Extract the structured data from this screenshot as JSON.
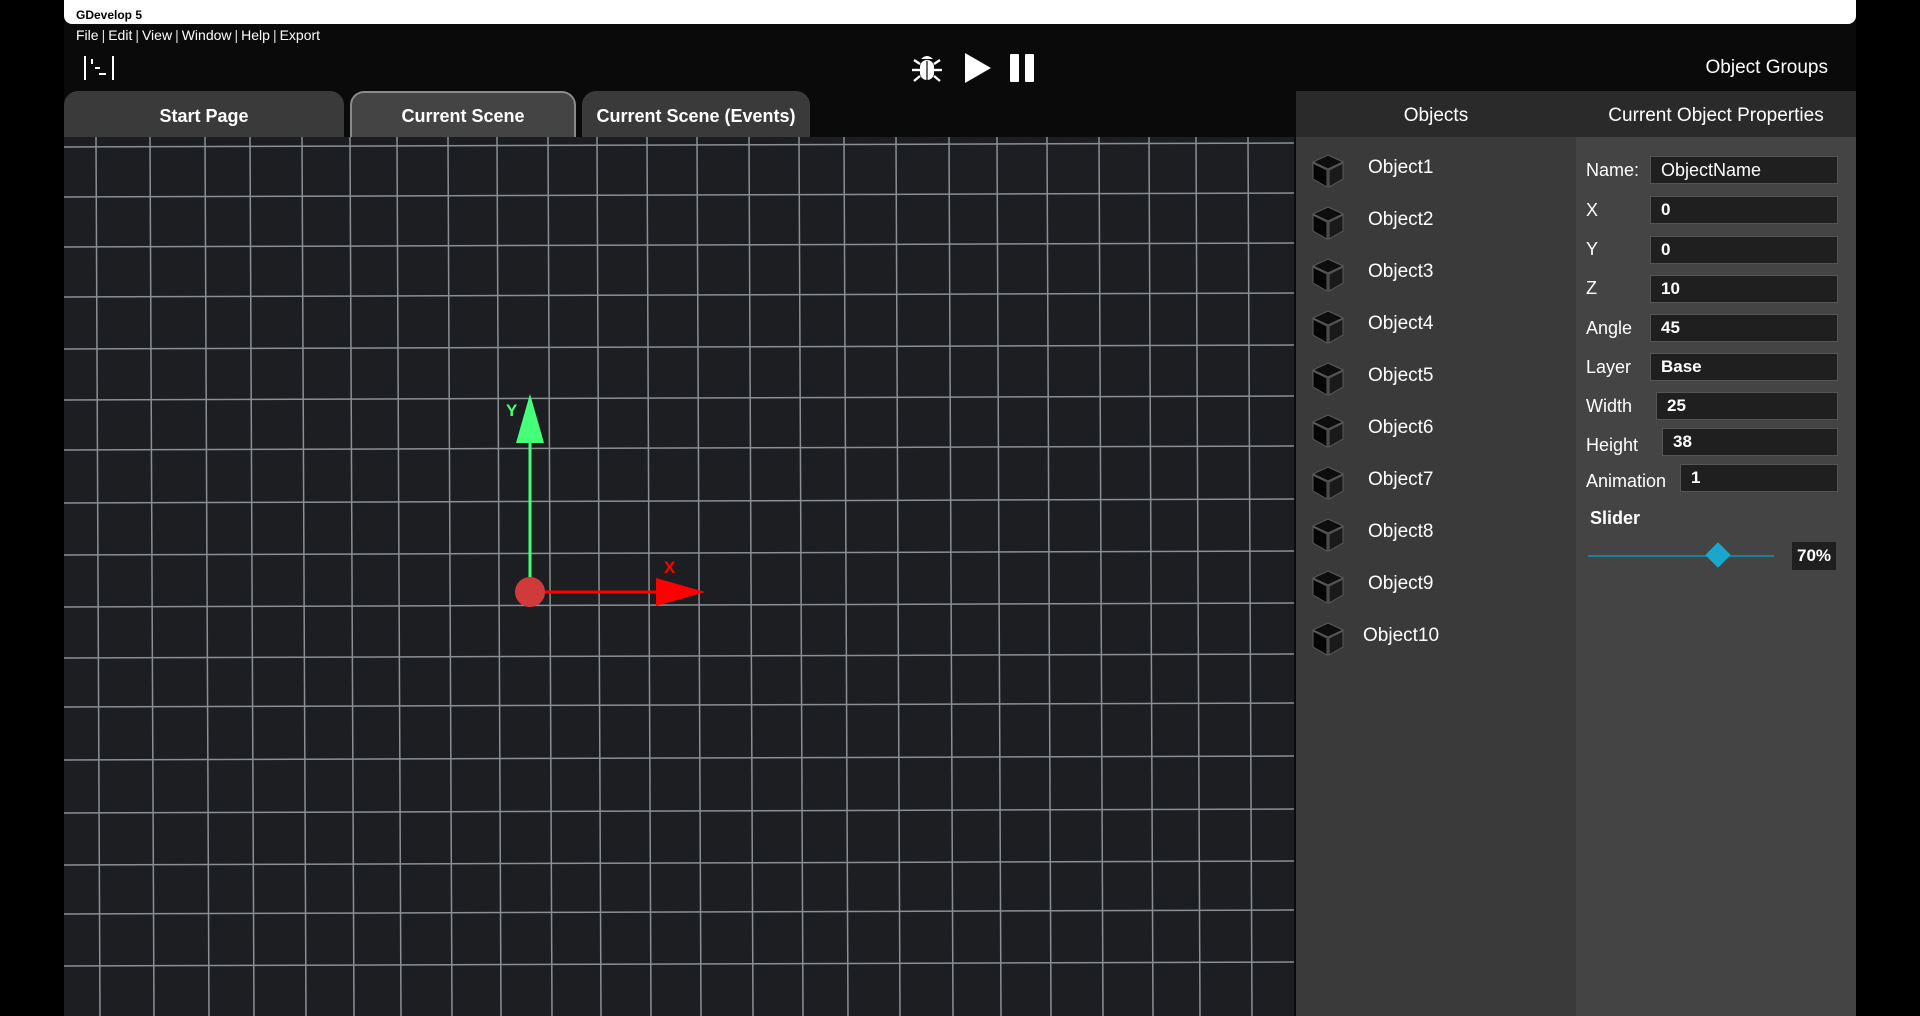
{
  "window": {
    "title": "GDevelop 5"
  },
  "menu": {
    "items": [
      "File",
      "Edit",
      "View",
      "Window",
      "Help",
      "Export"
    ]
  },
  "toolbar": {
    "object_groups_label": "Object Groups"
  },
  "tabs": [
    {
      "label": "Start Page",
      "active": false
    },
    {
      "label": "Current Scene",
      "active": true
    },
    {
      "label": "Current Scene (Events)",
      "active": false
    }
  ],
  "scene": {
    "y_axis_label": "Y",
    "x_axis_label": "X",
    "colors": {
      "x_axis": "#ff0000",
      "y_axis": "#44ff77",
      "origin": "#d13a3a",
      "grid": "#8a8f96",
      "background": "#1c1e22"
    }
  },
  "objects_panel": {
    "header": "Objects",
    "items": [
      "Object1",
      "Object2",
      "Object3",
      "Object4",
      "Object5",
      "Object6",
      "Object7",
      "Object8",
      "Object9",
      "Object10"
    ]
  },
  "properties_panel": {
    "header": "Current Object Properties",
    "name": {
      "label": "Name:",
      "value": "ObjectName"
    },
    "x": {
      "label": "X",
      "value": "0"
    },
    "y": {
      "label": "Y",
      "value": "0"
    },
    "z": {
      "label": "Z",
      "value": "10"
    },
    "angle": {
      "label": "Angle",
      "value": "45"
    },
    "layer": {
      "label": "Layer",
      "value": "Base"
    },
    "width": {
      "label": "Width",
      "value": "25"
    },
    "height": {
      "label": "Height",
      "value": "38"
    },
    "animation": {
      "label": "Animation",
      "value": "1"
    },
    "slider": {
      "label": "Slider",
      "value_text": "70%",
      "value": 0.7,
      "accent": "#19a7cc"
    }
  }
}
